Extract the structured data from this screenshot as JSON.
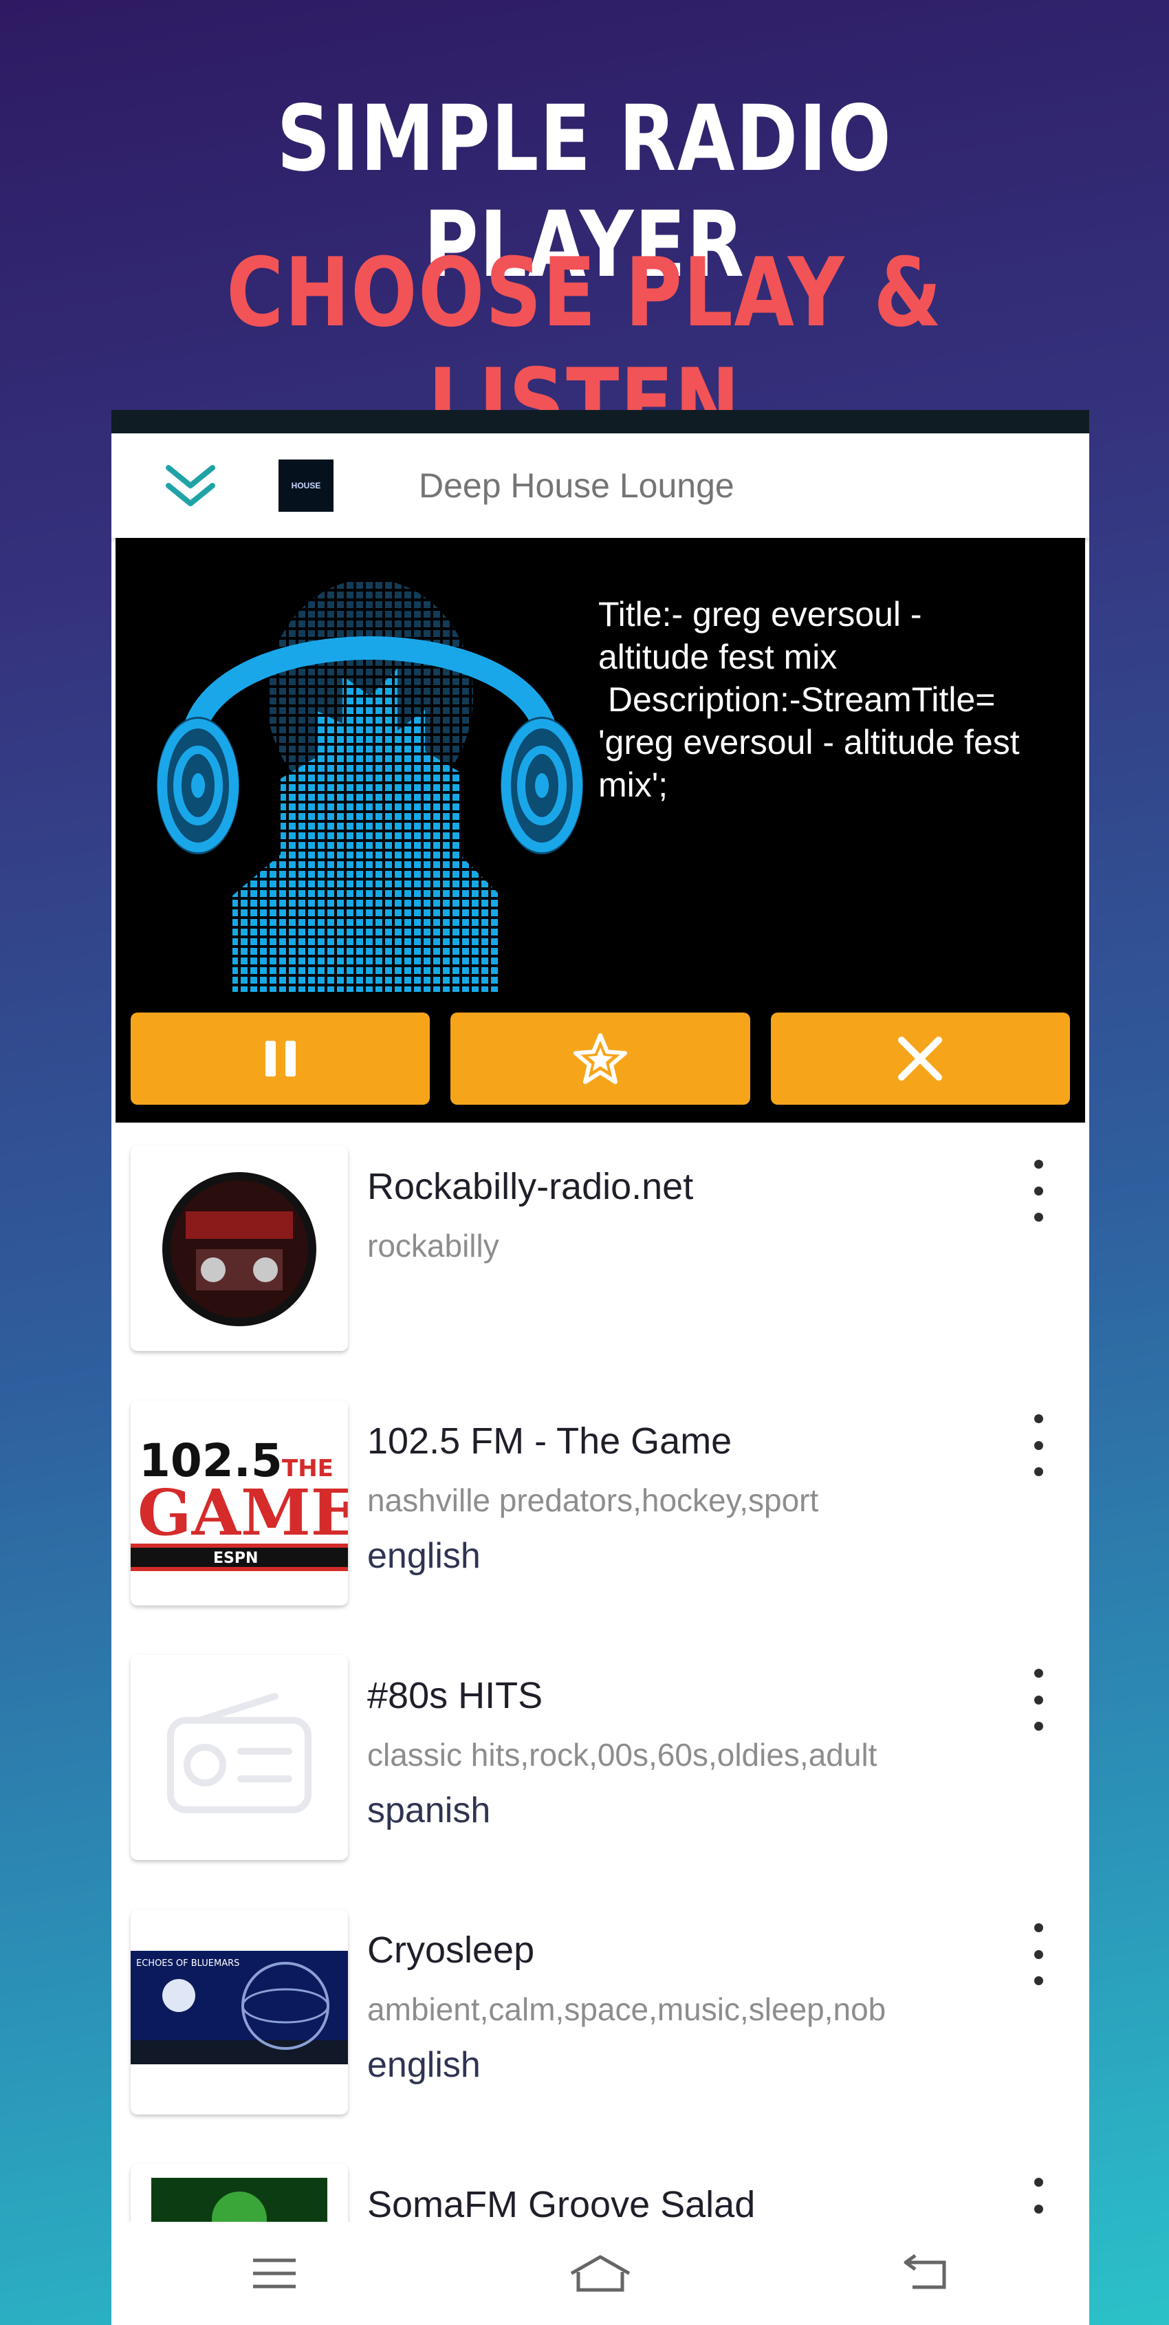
{
  "headline": {
    "line1": "SIMPLE RADIO PLAYER",
    "line2": "CHOOSE PLAY & LISTEN"
  },
  "appbar": {
    "station_logo_text": "HOUSE",
    "title": "Deep House Lounge"
  },
  "now_playing": {
    "line1": "Title:- greg eversoul -",
    "line2": "altitude fest mix",
    "line3": " Description:-StreamTitle=",
    "line4": "'greg eversoul - altitude fest",
    "line5": "mix';"
  },
  "controls": {
    "pause_icon": "pause-icon",
    "favorite_icon": "star-icon",
    "close_icon": "close-icon"
  },
  "stations": [
    {
      "name": "Rockabilly-radio.net",
      "tags": "rockabilly",
      "language": ""
    },
    {
      "name": "102.5 FM - The Game",
      "tags": "nashville predators,hockey,sport",
      "language": "english"
    },
    {
      "name": "#80s HITS",
      "tags": "classic hits,rock,00s,60s,oldies,adult",
      "language": "spanish"
    },
    {
      "name": "Cryosleep",
      "tags": "ambient,calm,space,music,sleep,nob",
      "language": "english"
    },
    {
      "name": "SomaFM Groove Salad",
      "tags": "",
      "language": ""
    }
  ],
  "thumbs": {
    "game_top": "102.5",
    "game_the": "THE",
    "game_main": "GAME",
    "game_espn": "ESPN",
    "cryo_label": "ECHOES OF BLUEMARS"
  },
  "colors": {
    "accent_orange": "#f6a51b",
    "accent_teal": "#1fa3a6",
    "headline_red": "#f25356"
  }
}
